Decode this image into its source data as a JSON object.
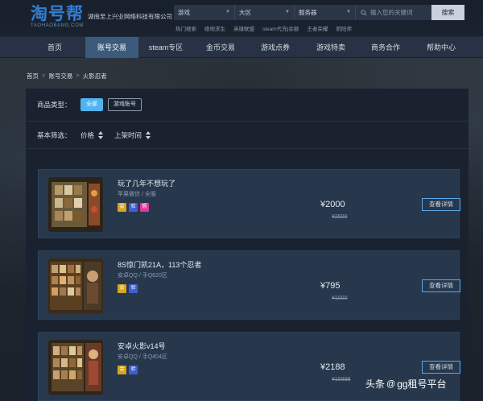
{
  "header": {
    "logo_main": "淘号帮",
    "logo_sub": "TAOHAOBANG.COM",
    "company": "湖南至上兴业网络科技有限公司",
    "search": {
      "game_placeholder": "游戏",
      "region_placeholder": "大区",
      "server_placeholder": "服务器",
      "keyword_placeholder": "输入您的关键词",
      "button": "搜索"
    },
    "hot_links": [
      "热门搜索",
      "绝地求生",
      "英雄联盟",
      "steam代充|余额",
      "王者荣耀",
      "阴阳师"
    ]
  },
  "nav": {
    "items": [
      "首页",
      "账号交易",
      "steam专区",
      "金币交易",
      "游戏点券",
      "游戏特卖",
      "商务合作",
      "帮助中心"
    ],
    "active_index": 1
  },
  "breadcrumb": [
    "首页",
    "账号交易",
    "火影忍者"
  ],
  "breadcrumb_sep": ">",
  "filters": {
    "type_label": "商品类型：",
    "type_options": [
      "全部",
      "游戏账号"
    ],
    "type_active_index": 0,
    "basic_label": "基本筛选：",
    "sorts": [
      "价格",
      "上架时间"
    ]
  },
  "products": [
    {
      "title": "玩了几年不想玩了",
      "sub": "苹果微信 / 全服",
      "tags": [
        {
          "text": "会",
          "color": "#d9a520"
        },
        {
          "text": "验",
          "color": "#3f5fd0"
        },
        {
          "text": "照",
          "color": "#e0399b"
        }
      ],
      "price": "¥2000",
      "orig": "¥2500",
      "button": "查看详情"
    },
    {
      "title": "8S惊门凯21A，113个忍者",
      "sub": "安卓QQ / 手Q620区",
      "tags": [
        {
          "text": "会",
          "color": "#d9a520"
        },
        {
          "text": "验",
          "color": "#3f5fd0"
        }
      ],
      "price": "¥795",
      "orig": "¥1000",
      "button": "查看详情"
    },
    {
      "title": "安卓火影v14号",
      "sub": "安卓QQ / 手Q404区",
      "tags": [
        {
          "text": "会",
          "color": "#d9a520"
        },
        {
          "text": "验",
          "color": "#3f5fd0"
        }
      ],
      "price": "¥2188",
      "orig": "¥15888",
      "button": "查看详情"
    }
  ],
  "watermark": {
    "prefix": "头条",
    "at": "@",
    "handle": "gg租号平台"
  },
  "colors": {
    "accent": "#4fb3f0",
    "nav_active": "#3c5a7b",
    "card_bg": "#27384d",
    "panel_bg": "#1a2230"
  }
}
